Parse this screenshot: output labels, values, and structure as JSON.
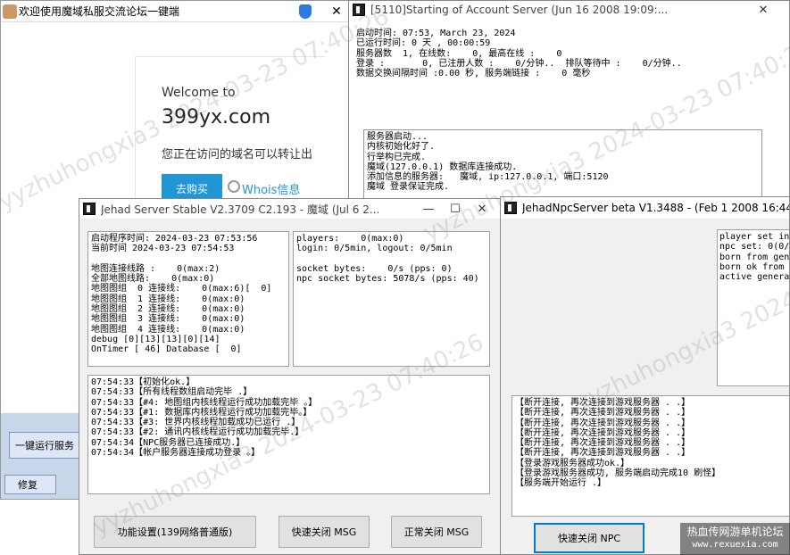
{
  "browser_window": {
    "title": "欢迎使用魔域私服交流论坛一键端",
    "welcome": "Welcome to",
    "domain": "399yx.com",
    "notice": "您正在访问的域名可以转让出",
    "buy_button": "去购买",
    "whois_link": "Whois信息",
    "run_button": "一键运行服务",
    "repair_button": "修复"
  },
  "account_server": {
    "title": "[5110]Starting of Account Server (Jun 16 2008 19:09:...",
    "info_lines": [
      "启动时间: 07:53, March 23, 2024",
      "已运行时间: 0 天 , 00:00:59",
      "服务器数  1, 在线数:    0, 最高在线 :    0",
      "登录 :       0, 已注册人数 :    0/分钟..  排队等待中 :    0/分钟..",
      "数据交换间隔时间 :0.00 秒, 服务端链接 :    0 毫秒"
    ],
    "log_lines": [
      "服务器启动...",
      "内核初始化好了.",
      "行举构已完成.",
      "魔域(127.0.0.1) 数据库连接成功.",
      "添加信息的服务器:   魔域, ip:127.0.0.1, 端口:5120",
      "魔域 登录保证完成."
    ]
  },
  "game_server": {
    "title": "Jehad Server Stable V2.3709 C2.193 - 魔域 (Jul  6 2...",
    "stats_left": [
      "启动程序时间: 2024-03-23 07:53:56",
      "当前时间 2024-03-23 07:54:53",
      "",
      "地图连接线路 :    0(max:2)",
      "全部地图线路:    0(max:0)",
      "地图图组  0 连接线:    0(max:6)[  0]",
      "地图图组  1 连接线:    0(max:0)",
      "地图图组  2 连接线:    0(max:0)",
      "地图图组  3 连接线:    0(max:0)",
      "地图图组  4 连接线:    0(max:0)",
      "debug [0][13][13][0][14]",
      "OnTimer [ 46] Database [  0]"
    ],
    "stats_right": [
      "players:    0(max:0)",
      "login: 0/5min, logout: 0/5min",
      "",
      "socket bytes:    0/s (pps: 0)",
      "npc socket bytes: 5078/s (pps: 40)"
    ],
    "log_lines": [
      "07:54:33【初始化ok.】",
      "07:54:33【所有线程数组启动完毕 .】",
      "07:54:33【#4: 地图组内核线程运行成功加载完毕 。】",
      "07:54:33【#1: 数据库内核线程运行成功加载完毕。】",
      "07:54:33【#3: 世界内核线程加载成功已运行 .】",
      "07:54:33【#2: 通讯内核线程运行成功加载完毕.】",
      "07:54:34【NPC服务器已连接成功.】",
      "07:54:34【帐户服务器连接成功登录 。】"
    ],
    "btn_settings": "功能设置(139网络普通版)",
    "btn_quick_close": "快速关闭 MSG",
    "btn_normal_close": "正常关闭 MSG"
  },
  "npc_server": {
    "title": "JehadNpcServer beta V1.3488 - (Feb  1 2008 16:44:3",
    "stats_lines": [
      "player set in",
      "npc set: 0(0/4",
      "born from gene",
      "born ok from g",
      "active generat"
    ],
    "log_lines": [
      "【断开连接, 再次连接到游戏服务器 . .】",
      "【断开连接, 再次连接到游戏服务器 . .】",
      "【断开连接, 再次连接到游戏服务器 . .】",
      "【断开连接, 再次连接到游戏服务器 . .】",
      "【断开连接, 再次连接到游戏服务器 . .】",
      "【断开连接, 再次连接到游戏服务器 . .】",
      "【登录游戏服务器成功ok.】",
      "【登录游戏服务器成功, 服务端启动完成10 刷怪】",
      "【服务端开始运行 .】"
    ],
    "btn_quick_close": "快速关闭 NPC"
  },
  "corner_watermark": {
    "cn": "热血传网游单机论坛",
    "url": "www.rexuexia.com"
  },
  "watermark_text": "yyzhuhongxia3 2024-03-23 07:40:26"
}
